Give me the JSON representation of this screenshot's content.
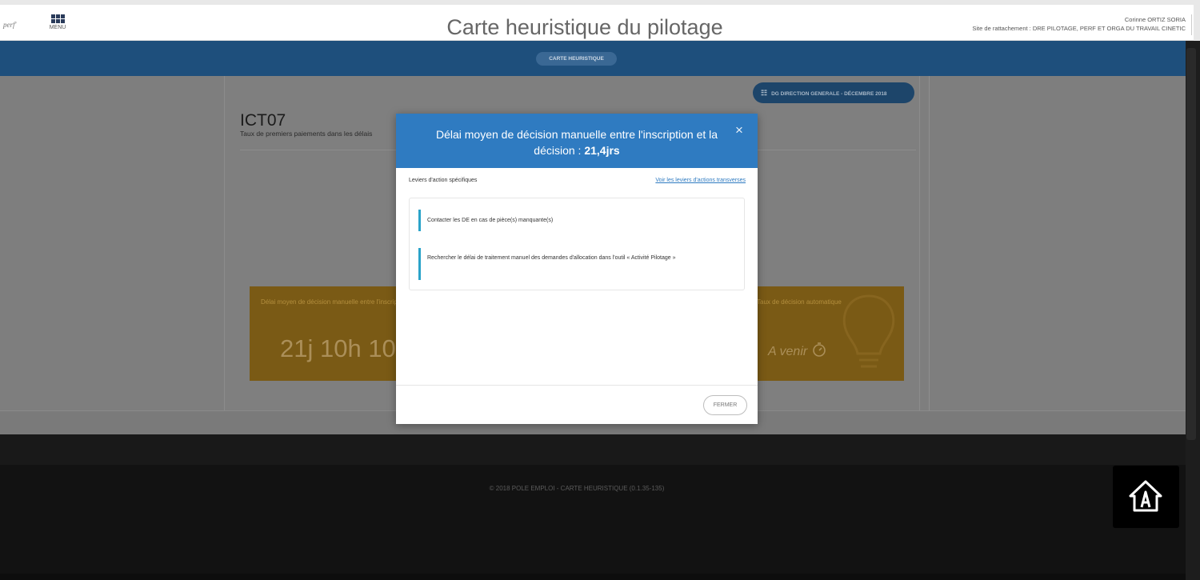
{
  "header": {
    "logo_text": "perf'",
    "menu_label": "MENU",
    "title": "Carte heuristique du pilotage",
    "user_name": "Corinne ORTIZ SORIA",
    "user_site": "Site de rattachement : DRE PILOTAGE, PERF ET ORGA DU TRAVAIL CINETIC"
  },
  "nav": {
    "active_tab": "CARTE HEURISTIQUE"
  },
  "page": {
    "scope_pill": "DG DIRECTION GENERALE - DÉCEMBRE 2018",
    "indicator_code": "ICT07",
    "indicator_label": "Taux de premiers paiements dans les délais"
  },
  "cards": {
    "left_title": "Délai moyen de décision manuelle entre l'inscription et la décision",
    "left_value": "21j 10h 10min",
    "right_title": "Taux de décision automatique",
    "right_value": "A venir",
    "right_icon": "stopwatch-icon",
    "card_color": "#F0A000"
  },
  "modal": {
    "title_prefix": "Délai moyen de décision manuelle entre l'inscription et la décision : ",
    "title_value": "21,4jrs",
    "close_icon": "×",
    "levers_label": "Leviers d'action spécifiques",
    "levers_link": "Voir les leviers d'actions transverses",
    "levers": [
      "Contacter les DE en cas de pièce(s) manquante(s)",
      "Rechercher le délai de traitement manuel des demandes d'allocation dans l'outil « Activité Pilotage »"
    ],
    "close_button": "FERMER",
    "header_color": "#2F7BC1",
    "accent_color": "#2AA3C9"
  },
  "footer": {
    "copyright": "© 2018 POLE EMPLOI - CARTE HEURISTIQUE (0.1.35-135)",
    "badge_icon": "a-house-logo-icon"
  }
}
